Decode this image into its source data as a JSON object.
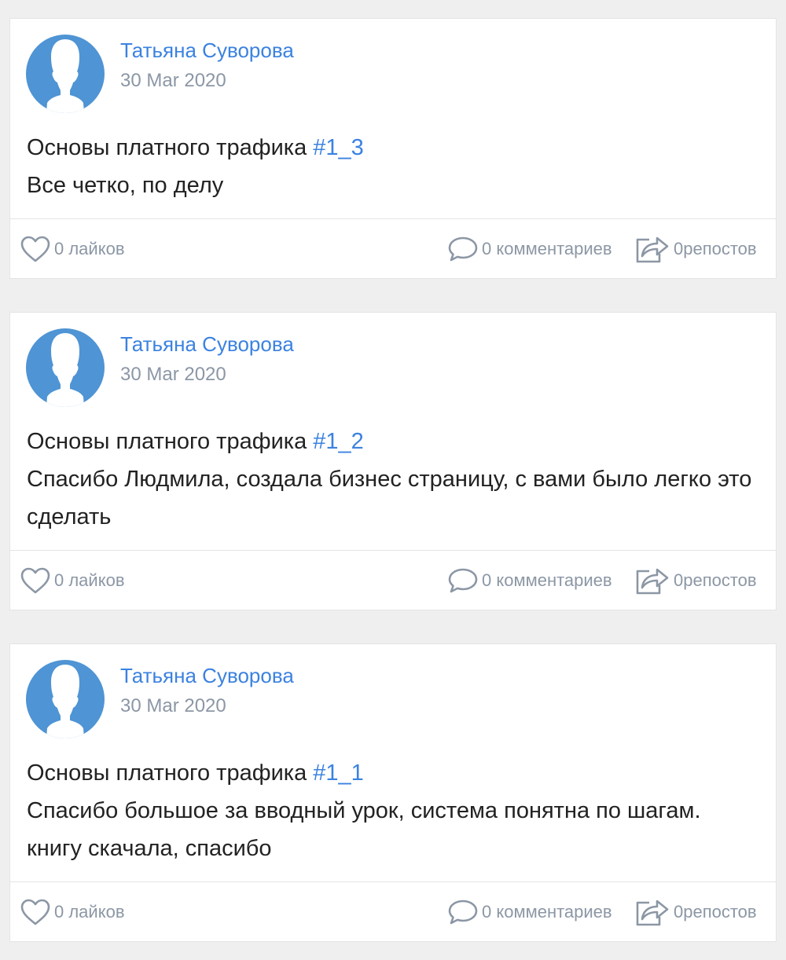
{
  "colors": {
    "background": "#efefef",
    "card": "#ffffff",
    "link": "#3b82e0",
    "muted": "#8c97a5",
    "avatar": "#4f94d4"
  },
  "posts": [
    {
      "author": "Татьяна Суворова",
      "date": "30 Mar 2020",
      "title": "Основы платного трафика ",
      "hashtag": "#1_3",
      "text": "Все четко, по делу",
      "likes_label": "0 лайков",
      "comments_label": "0 комментариев",
      "reposts_label": "0репостов"
    },
    {
      "author": "Татьяна Суворова",
      "date": "30 Mar 2020",
      "title": "Основы платного трафика ",
      "hashtag": "#1_2",
      "text": "Спасибо Людмила, создала бизнес страницу, с вами было легко это сделать",
      "likes_label": "0 лайков",
      "comments_label": "0 комментариев",
      "reposts_label": "0репостов"
    },
    {
      "author": "Татьяна Суворова",
      "date": "30 Mar 2020",
      "title": "Основы платного трафика ",
      "hashtag": "#1_1",
      "text": "Спасибо большое за вводный урок, система понятна по шагам. книгу скачала, спасибо",
      "likes_label": "0 лайков",
      "comments_label": "0 комментариев",
      "reposts_label": "0репостов"
    }
  ]
}
